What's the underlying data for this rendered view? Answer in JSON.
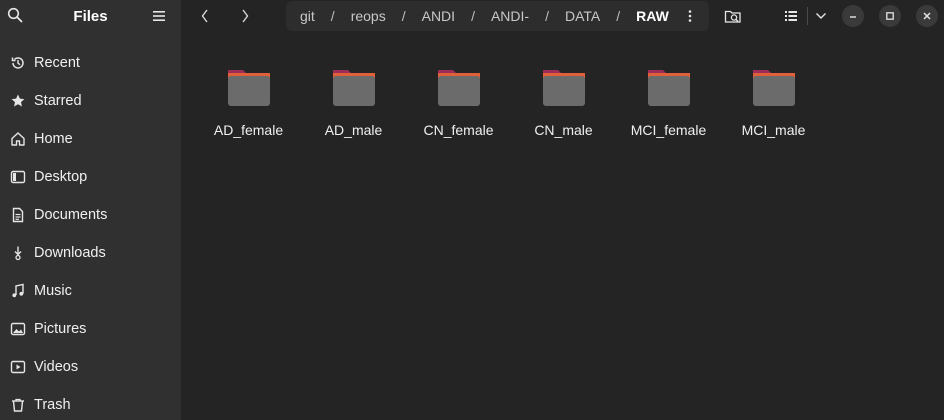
{
  "app": {
    "title": "Files"
  },
  "sidebar": {
    "items": [
      {
        "label": "Recent",
        "icon": "clock-icon"
      },
      {
        "label": "Starred",
        "icon": "star-icon"
      },
      {
        "label": "Home",
        "icon": "home-icon"
      },
      {
        "label": "Desktop",
        "icon": "desktop-icon"
      },
      {
        "label": "Documents",
        "icon": "document-icon"
      },
      {
        "label": "Downloads",
        "icon": "download-icon"
      },
      {
        "label": "Music",
        "icon": "music-icon"
      },
      {
        "label": "Pictures",
        "icon": "picture-icon"
      },
      {
        "label": "Videos",
        "icon": "video-icon"
      },
      {
        "label": "Trash",
        "icon": "trash-icon"
      }
    ]
  },
  "pathbar": {
    "crumbs": [
      "git",
      "reops",
      "ANDI",
      "ANDI-",
      "DATA",
      "RAW"
    ],
    "separator": "/"
  },
  "files": [
    {
      "name": "AD_female",
      "type": "folder"
    },
    {
      "name": "AD_male",
      "type": "folder"
    },
    {
      "name": "CN_female",
      "type": "folder"
    },
    {
      "name": "CN_male",
      "type": "folder"
    },
    {
      "name": "MCI_female",
      "type": "folder"
    },
    {
      "name": "MCI_male",
      "type": "folder"
    }
  ],
  "colors": {
    "sidebar_bg": "#303030",
    "main_bg": "#242424",
    "folder_body": "#6b6b6b",
    "folder_tab": "#9c2d59",
    "folder_accent": "#e0603a"
  }
}
